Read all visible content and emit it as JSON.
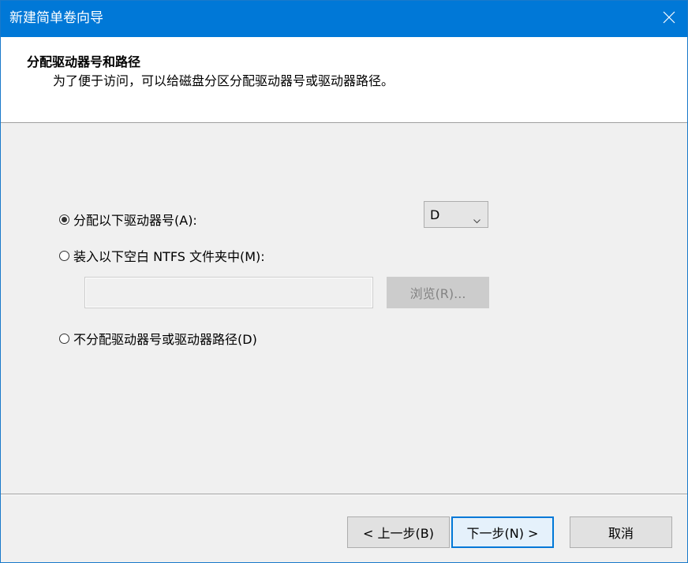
{
  "window": {
    "title": "新建简单卷向导"
  },
  "header": {
    "title": "分配驱动器号和路径",
    "subtitle": "为了便于访问，可以给磁盘分区分配驱动器号或驱动器路径。"
  },
  "options": {
    "assign_letter": {
      "label": "分配以下驱动器号(A):",
      "selected": true,
      "drive_letter": "D"
    },
    "mount_folder": {
      "label": "装入以下空白 NTFS 文件夹中(M):",
      "selected": false,
      "path_value": "",
      "browse_label": "浏览(R)..."
    },
    "no_assign": {
      "label": "不分配驱动器号或驱动器路径(D)",
      "selected": false
    }
  },
  "footer": {
    "back_label": "< 上一步(B)",
    "next_label": "下一步(N) >",
    "cancel_label": "取消"
  },
  "colors": {
    "titlebar": "#0078d7",
    "default_button_border": "#0078d7"
  },
  "icons": {
    "close": "close-icon",
    "dropdown": "chevron-down-icon"
  }
}
